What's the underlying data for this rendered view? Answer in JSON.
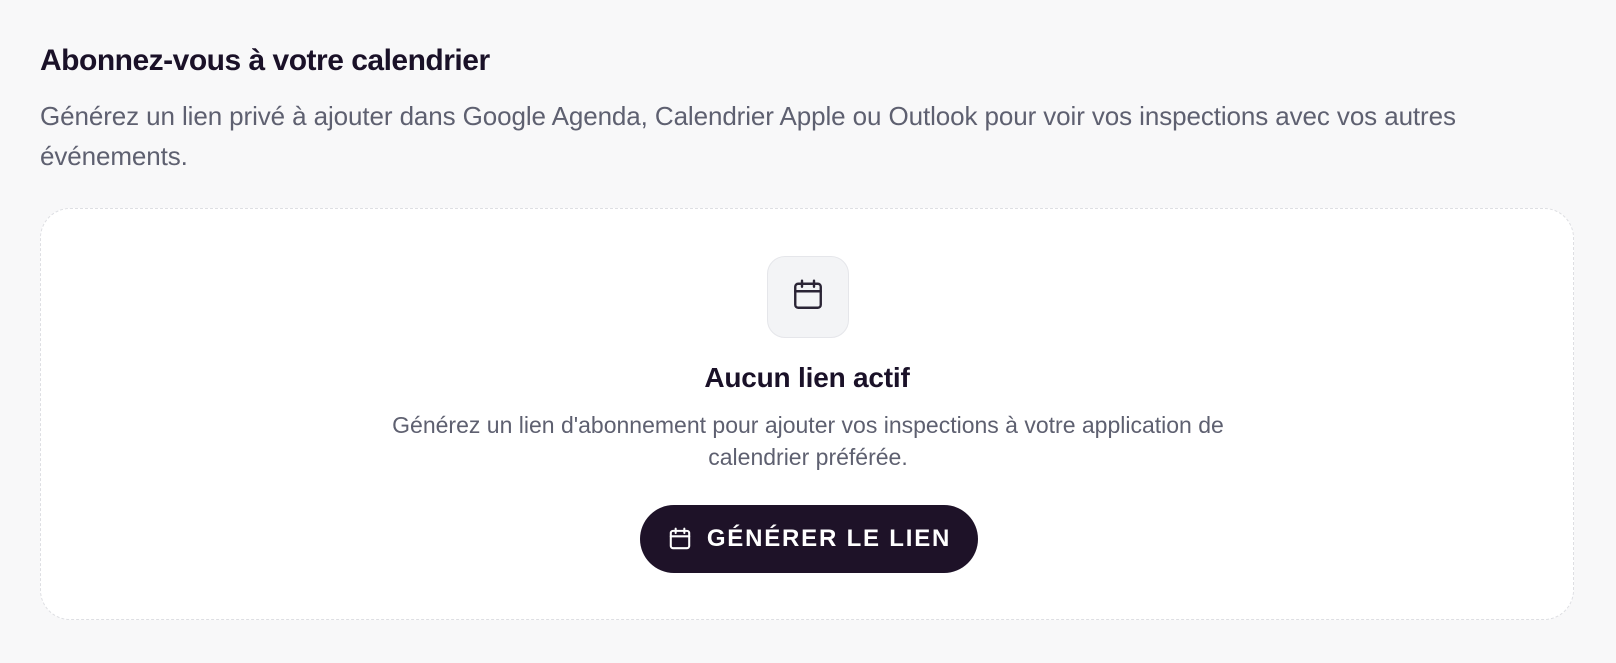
{
  "section": {
    "title": "Abonnez-vous à votre calendrier",
    "description": "Générez un lien privé à ajouter dans Google Agenda, Calendrier Apple ou Outlook pour voir vos inspections avec vos autres événements."
  },
  "empty_state": {
    "icon": "calendar-icon",
    "title": "Aucun lien actif",
    "description": "Générez un lien d'abonnement pour ajouter vos inspections à votre application de calendrier préférée.",
    "button": {
      "label": "GÉNÉRER LE LIEN",
      "icon": "calendar-icon"
    }
  },
  "colors": {
    "background": "#f8f8f9",
    "card": "#ffffff",
    "primary_button": "#1e1228",
    "heading": "#1a1128",
    "muted_text": "#5e6070"
  }
}
